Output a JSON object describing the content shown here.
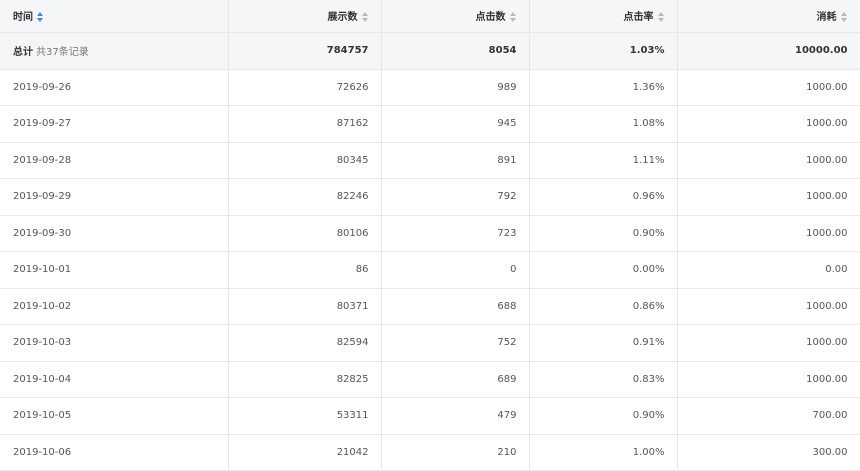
{
  "columns": [
    {
      "label": "时间",
      "sortable": true
    },
    {
      "label": "展示数",
      "sortable": true
    },
    {
      "label": "点击数",
      "sortable": true
    },
    {
      "label": "点击率",
      "sortable": true
    },
    {
      "label": "消耗",
      "sortable": true
    }
  ],
  "total": {
    "label": "总计",
    "count_text": "共37条记录",
    "impressions": "784757",
    "clicks": "8054",
    "ctr": "1.03%",
    "cost": "10000.00"
  },
  "rows": [
    {
      "date": "2019-09-26",
      "impressions": "72626",
      "clicks": "989",
      "ctr": "1.36%",
      "cost": "1000.00"
    },
    {
      "date": "2019-09-27",
      "impressions": "87162",
      "clicks": "945",
      "ctr": "1.08%",
      "cost": "1000.00"
    },
    {
      "date": "2019-09-28",
      "impressions": "80345",
      "clicks": "891",
      "ctr": "1.11%",
      "cost": "1000.00"
    },
    {
      "date": "2019-09-29",
      "impressions": "82246",
      "clicks": "792",
      "ctr": "0.96%",
      "cost": "1000.00"
    },
    {
      "date": "2019-09-30",
      "impressions": "80106",
      "clicks": "723",
      "ctr": "0.90%",
      "cost": "1000.00"
    },
    {
      "date": "2019-10-01",
      "impressions": "86",
      "clicks": "0",
      "ctr": "0.00%",
      "cost": "0.00"
    },
    {
      "date": "2019-10-02",
      "impressions": "80371",
      "clicks": "688",
      "ctr": "0.86%",
      "cost": "1000.00"
    },
    {
      "date": "2019-10-03",
      "impressions": "82594",
      "clicks": "752",
      "ctr": "0.91%",
      "cost": "1000.00"
    },
    {
      "date": "2019-10-04",
      "impressions": "82825",
      "clicks": "689",
      "ctr": "0.83%",
      "cost": "1000.00"
    },
    {
      "date": "2019-10-05",
      "impressions": "53311",
      "clicks": "479",
      "ctr": "0.90%",
      "cost": "700.00"
    },
    {
      "date": "2019-10-06",
      "impressions": "21042",
      "clicks": "210",
      "ctr": "1.00%",
      "cost": "300.00"
    }
  ],
  "colors": {
    "sort_active": "#3b87f5",
    "sort_inactive": "#b5b9c0",
    "header_bg": "#f5f6f7"
  }
}
